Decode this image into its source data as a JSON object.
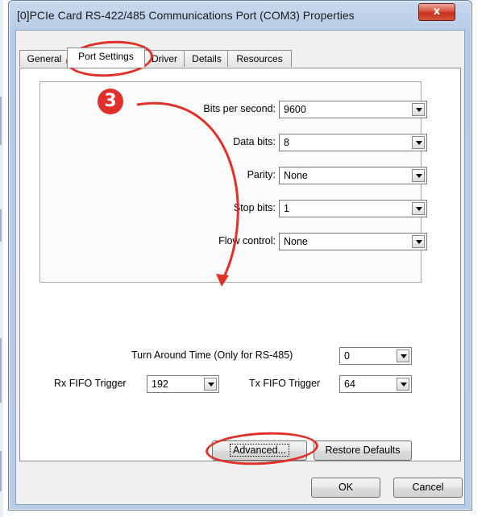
{
  "window": {
    "title": "[0]PCIe Card RS-422/485 Communications Port (COM3) Properties",
    "close_glyph": "x"
  },
  "tabs": [
    "General",
    "Port Settings",
    "Driver",
    "Details",
    "Resources"
  ],
  "active_tab": "Port Settings",
  "port_settings": {
    "bits_per_second": {
      "label": "Bits per second:",
      "value": "9600"
    },
    "data_bits": {
      "label": "Data bits:",
      "value": "8"
    },
    "parity": {
      "label": "Parity:",
      "value": "None"
    },
    "stop_bits": {
      "label": "Stop bits:",
      "value": "1"
    },
    "flow_control": {
      "label": "Flow control:",
      "value": "None"
    }
  },
  "advanced_settings": {
    "turn_around_time": {
      "label": "Turn Around Time (Only for RS-485)",
      "value": "0"
    },
    "rx_fifo": {
      "label": "Rx FIFO Trigger",
      "value": "192"
    },
    "tx_fifo": {
      "label": "Tx FIFO Trigger",
      "value": "64"
    }
  },
  "buttons": {
    "advanced": "Advanced...",
    "restore_defaults": "Restore Defaults",
    "ok": "OK",
    "cancel": "Cancel"
  },
  "annotation": {
    "step_number": "3",
    "color": "#e0302a"
  }
}
